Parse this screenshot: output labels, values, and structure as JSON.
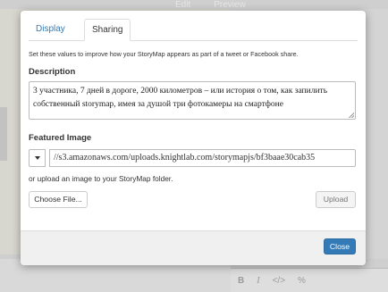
{
  "background": {
    "tabs": [
      "Edit",
      "Preview"
    ],
    "editor_toolbar": [
      "B",
      "I",
      "</>",
      "%"
    ]
  },
  "modal": {
    "tabs": [
      {
        "label": "Display",
        "active": false
      },
      {
        "label": "Sharing",
        "active": true
      }
    ],
    "intro": "Set these values to improve how your StoryMap appears as part of a tweet or Facebook share.",
    "description": {
      "label": "Description",
      "value": "3 участника, 7 дней в дороге, 2000 километров – или история о том, как запилить собственный storymap, имея за душой три фотокамеры на смартфоне"
    },
    "featured_image": {
      "label": "Featured Image",
      "url": "//s3.amazonaws.com/uploads.knightlab.com/storymapjs/bf3baae30cab35",
      "upload_hint": "or upload an image to your StoryMap folder.",
      "choose_label": "Choose File...",
      "upload_label": "Upload"
    },
    "close_label": "Close"
  },
  "colors": {
    "primary": "#337ab7",
    "tab_link": "#337ab7",
    "overlay": "#cfcfcf"
  }
}
